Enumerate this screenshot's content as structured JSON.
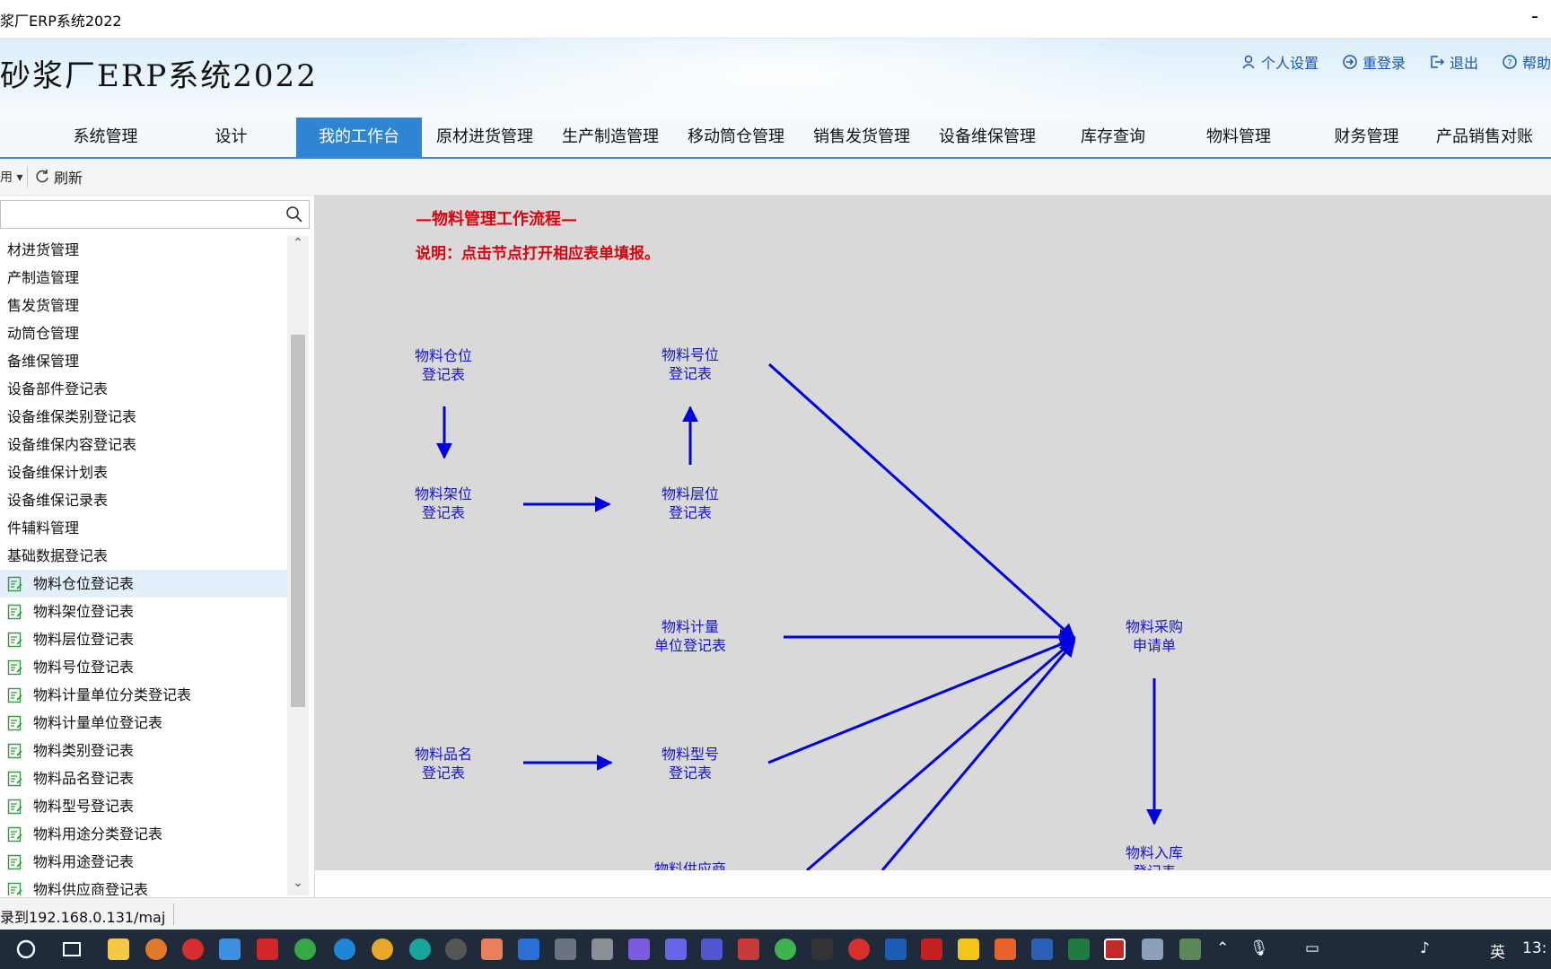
{
  "window": {
    "title": "浆厂ERP系统2022",
    "minimize_glyph": "-"
  },
  "header": {
    "app_title": "砂浆厂ERP系统2022",
    "links": [
      {
        "label": "个人设置",
        "icon": "user-icon"
      },
      {
        "label": "重登录",
        "icon": "relogin-icon"
      },
      {
        "label": "退出",
        "icon": "exit-icon"
      },
      {
        "label": "帮助",
        "icon": "help-icon"
      }
    ]
  },
  "nav": {
    "tabs": [
      {
        "label": "系统管理"
      },
      {
        "label": "设计"
      },
      {
        "label": "我的工作台",
        "active": true
      },
      {
        "label": "原材进货管理"
      },
      {
        "label": "生产制造管理"
      },
      {
        "label": "移动筒仓管理"
      },
      {
        "label": "销售发货管理"
      },
      {
        "label": "设备维保管理"
      },
      {
        "label": "库存查询"
      },
      {
        "label": "物料管理"
      },
      {
        "label": "财务管理"
      },
      {
        "label": "产品销售对账"
      }
    ]
  },
  "toolbar": {
    "dropdown_label": "用",
    "refresh_label": "刷新"
  },
  "sidebar": {
    "search_placeholder": "",
    "items": [
      {
        "label": "材进货管理",
        "level": 1
      },
      {
        "label": "产制造管理",
        "level": 1
      },
      {
        "label": "售发货管理",
        "level": 1
      },
      {
        "label": "动筒仓管理",
        "level": 1
      },
      {
        "label": "备维保管理",
        "level": 1
      },
      {
        "label": "设备部件登记表",
        "level": 1
      },
      {
        "label": "设备维保类别登记表",
        "level": 1
      },
      {
        "label": "设备维保内容登记表",
        "level": 1
      },
      {
        "label": "设备维保计划表",
        "level": 1
      },
      {
        "label": "设备维保记录表",
        "level": 1
      },
      {
        "label": "件辅料管理",
        "level": 1
      },
      {
        "label": "基础数据登记表",
        "level": 1
      },
      {
        "label": "物料仓位登记表",
        "level": 2,
        "selected": true
      },
      {
        "label": "物料架位登记表",
        "level": 2
      },
      {
        "label": "物料层位登记表",
        "level": 2
      },
      {
        "label": "物料号位登记表",
        "level": 2
      },
      {
        "label": "物料计量单位分类登记表",
        "level": 2
      },
      {
        "label": "物料计量单位登记表",
        "level": 2
      },
      {
        "label": "物料类别登记表",
        "level": 2
      },
      {
        "label": "物料品名登记表",
        "level": 2
      },
      {
        "label": "物料型号登记表",
        "level": 2
      },
      {
        "label": "物料用途分类登记表",
        "level": 2
      },
      {
        "label": "物料用途登记表",
        "level": 2
      },
      {
        "label": "物料供应商登记表",
        "level": 2
      }
    ]
  },
  "workflow": {
    "title": "—物料管理工作流程—",
    "note": "说明：点击节点打开相应表单填报。",
    "nodes": [
      {
        "id": "n1",
        "label": "物料仓位\n登记表"
      },
      {
        "id": "n2",
        "label": "物料号位\n登记表"
      },
      {
        "id": "n3",
        "label": "物料架位\n登记表"
      },
      {
        "id": "n4",
        "label": "物料层位\n登记表"
      },
      {
        "id": "n5",
        "label": "物料计量\n单位登记表"
      },
      {
        "id": "n6",
        "label": "物料采购\n申请单"
      },
      {
        "id": "n7",
        "label": "物料品名\n登记表"
      },
      {
        "id": "n8",
        "label": "物料型号\n登记表"
      },
      {
        "id": "n9",
        "label": "物料供应商"
      },
      {
        "id": "n10",
        "label": "物料入库\n登记表"
      }
    ],
    "arrow_color": "#0000e0"
  },
  "status": {
    "text": "录到192.168.0.131/maj"
  },
  "taskbar": {
    "ime": "英",
    "clock": "13:"
  }
}
